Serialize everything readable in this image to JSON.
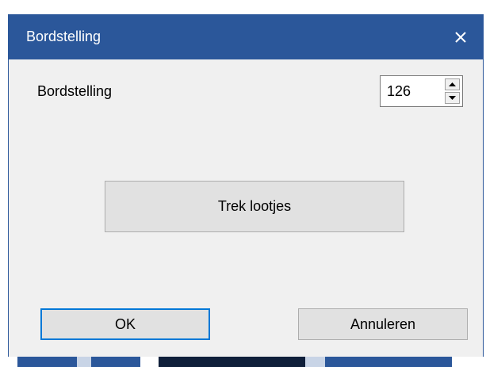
{
  "dialog": {
    "title": "Bordstelling",
    "close_glyph": "✕",
    "close_icon": "close-icon"
  },
  "field": {
    "label": "Bordstelling",
    "value": "126",
    "spin_up_icon": "arrow-up-icon",
    "spin_down_icon": "arrow-down-icon"
  },
  "buttons": {
    "draw": "Trek lootjes",
    "ok": "OK",
    "cancel": "Annuleren"
  },
  "colors": {
    "titlebar": "#2b579a",
    "dialog_bg": "#f0f0f0",
    "button_bg": "#e1e1e1",
    "focus_border": "#0078d7"
  }
}
